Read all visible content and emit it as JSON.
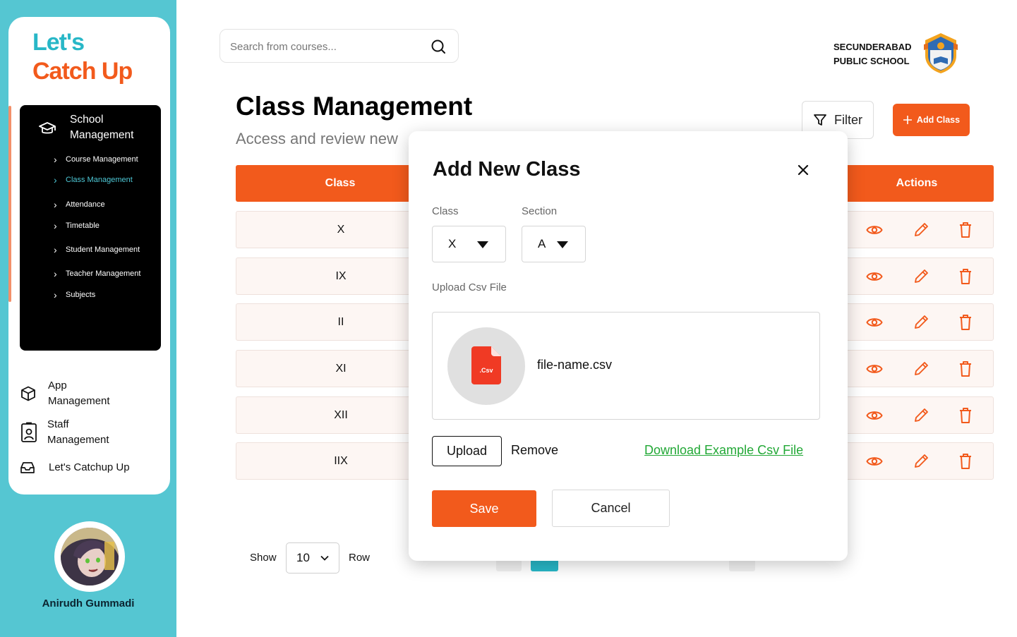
{
  "app": {
    "logo_line1": "Let's",
    "logo_line2": "Catch Up"
  },
  "sidebar": {
    "main_section": "School Management",
    "sub_items": [
      {
        "label": "Course Management"
      },
      {
        "label": "Class Management",
        "active": true
      },
      {
        "label": "Attendance"
      },
      {
        "label": "Timetable"
      },
      {
        "label": "Student Management"
      },
      {
        "label": "Teacher Management"
      },
      {
        "label": "Subjects"
      }
    ],
    "bottom_items": [
      {
        "label": "App Management",
        "icon": "cube-icon"
      },
      {
        "label": "Staff Management",
        "icon": "staff-badge-icon"
      },
      {
        "label": "Let's Catchup Up",
        "icon": "inbox-icon"
      }
    ],
    "user_name": "Anirudh Gummadi"
  },
  "header": {
    "search_placeholder": "Search from courses...",
    "school_name_line1": "SECUNDERABAD",
    "school_name_line2": "PUBLIC SCHOOL"
  },
  "page": {
    "title": "Class Management",
    "subtitle": "Access and review new",
    "filter_label": "Filter",
    "add_label": "Add Class"
  },
  "table": {
    "col_class": "Class",
    "col_actions": "Actions",
    "rows": [
      "X",
      "IX",
      "II",
      "XI",
      "XII",
      "IIX"
    ]
  },
  "pagination": {
    "show_label": "Show",
    "rows_value": "10",
    "row_label": "Row"
  },
  "modal": {
    "title": "Add New Class",
    "class_label": "Class",
    "class_value": "X",
    "section_label": "Section",
    "section_value": "A",
    "upload_label": "Upload Csv File",
    "file_badge": ".Csv",
    "file_name": "file-name.csv",
    "upload_btn": "Upload",
    "remove_btn": "Remove",
    "download_link": "Download Example Csv File",
    "save_btn": "Save",
    "cancel_btn": "Cancel"
  },
  "colors": {
    "brand_orange": "#f25a1c",
    "brand_teal": "#55c6d2",
    "link_green": "#22a836"
  }
}
